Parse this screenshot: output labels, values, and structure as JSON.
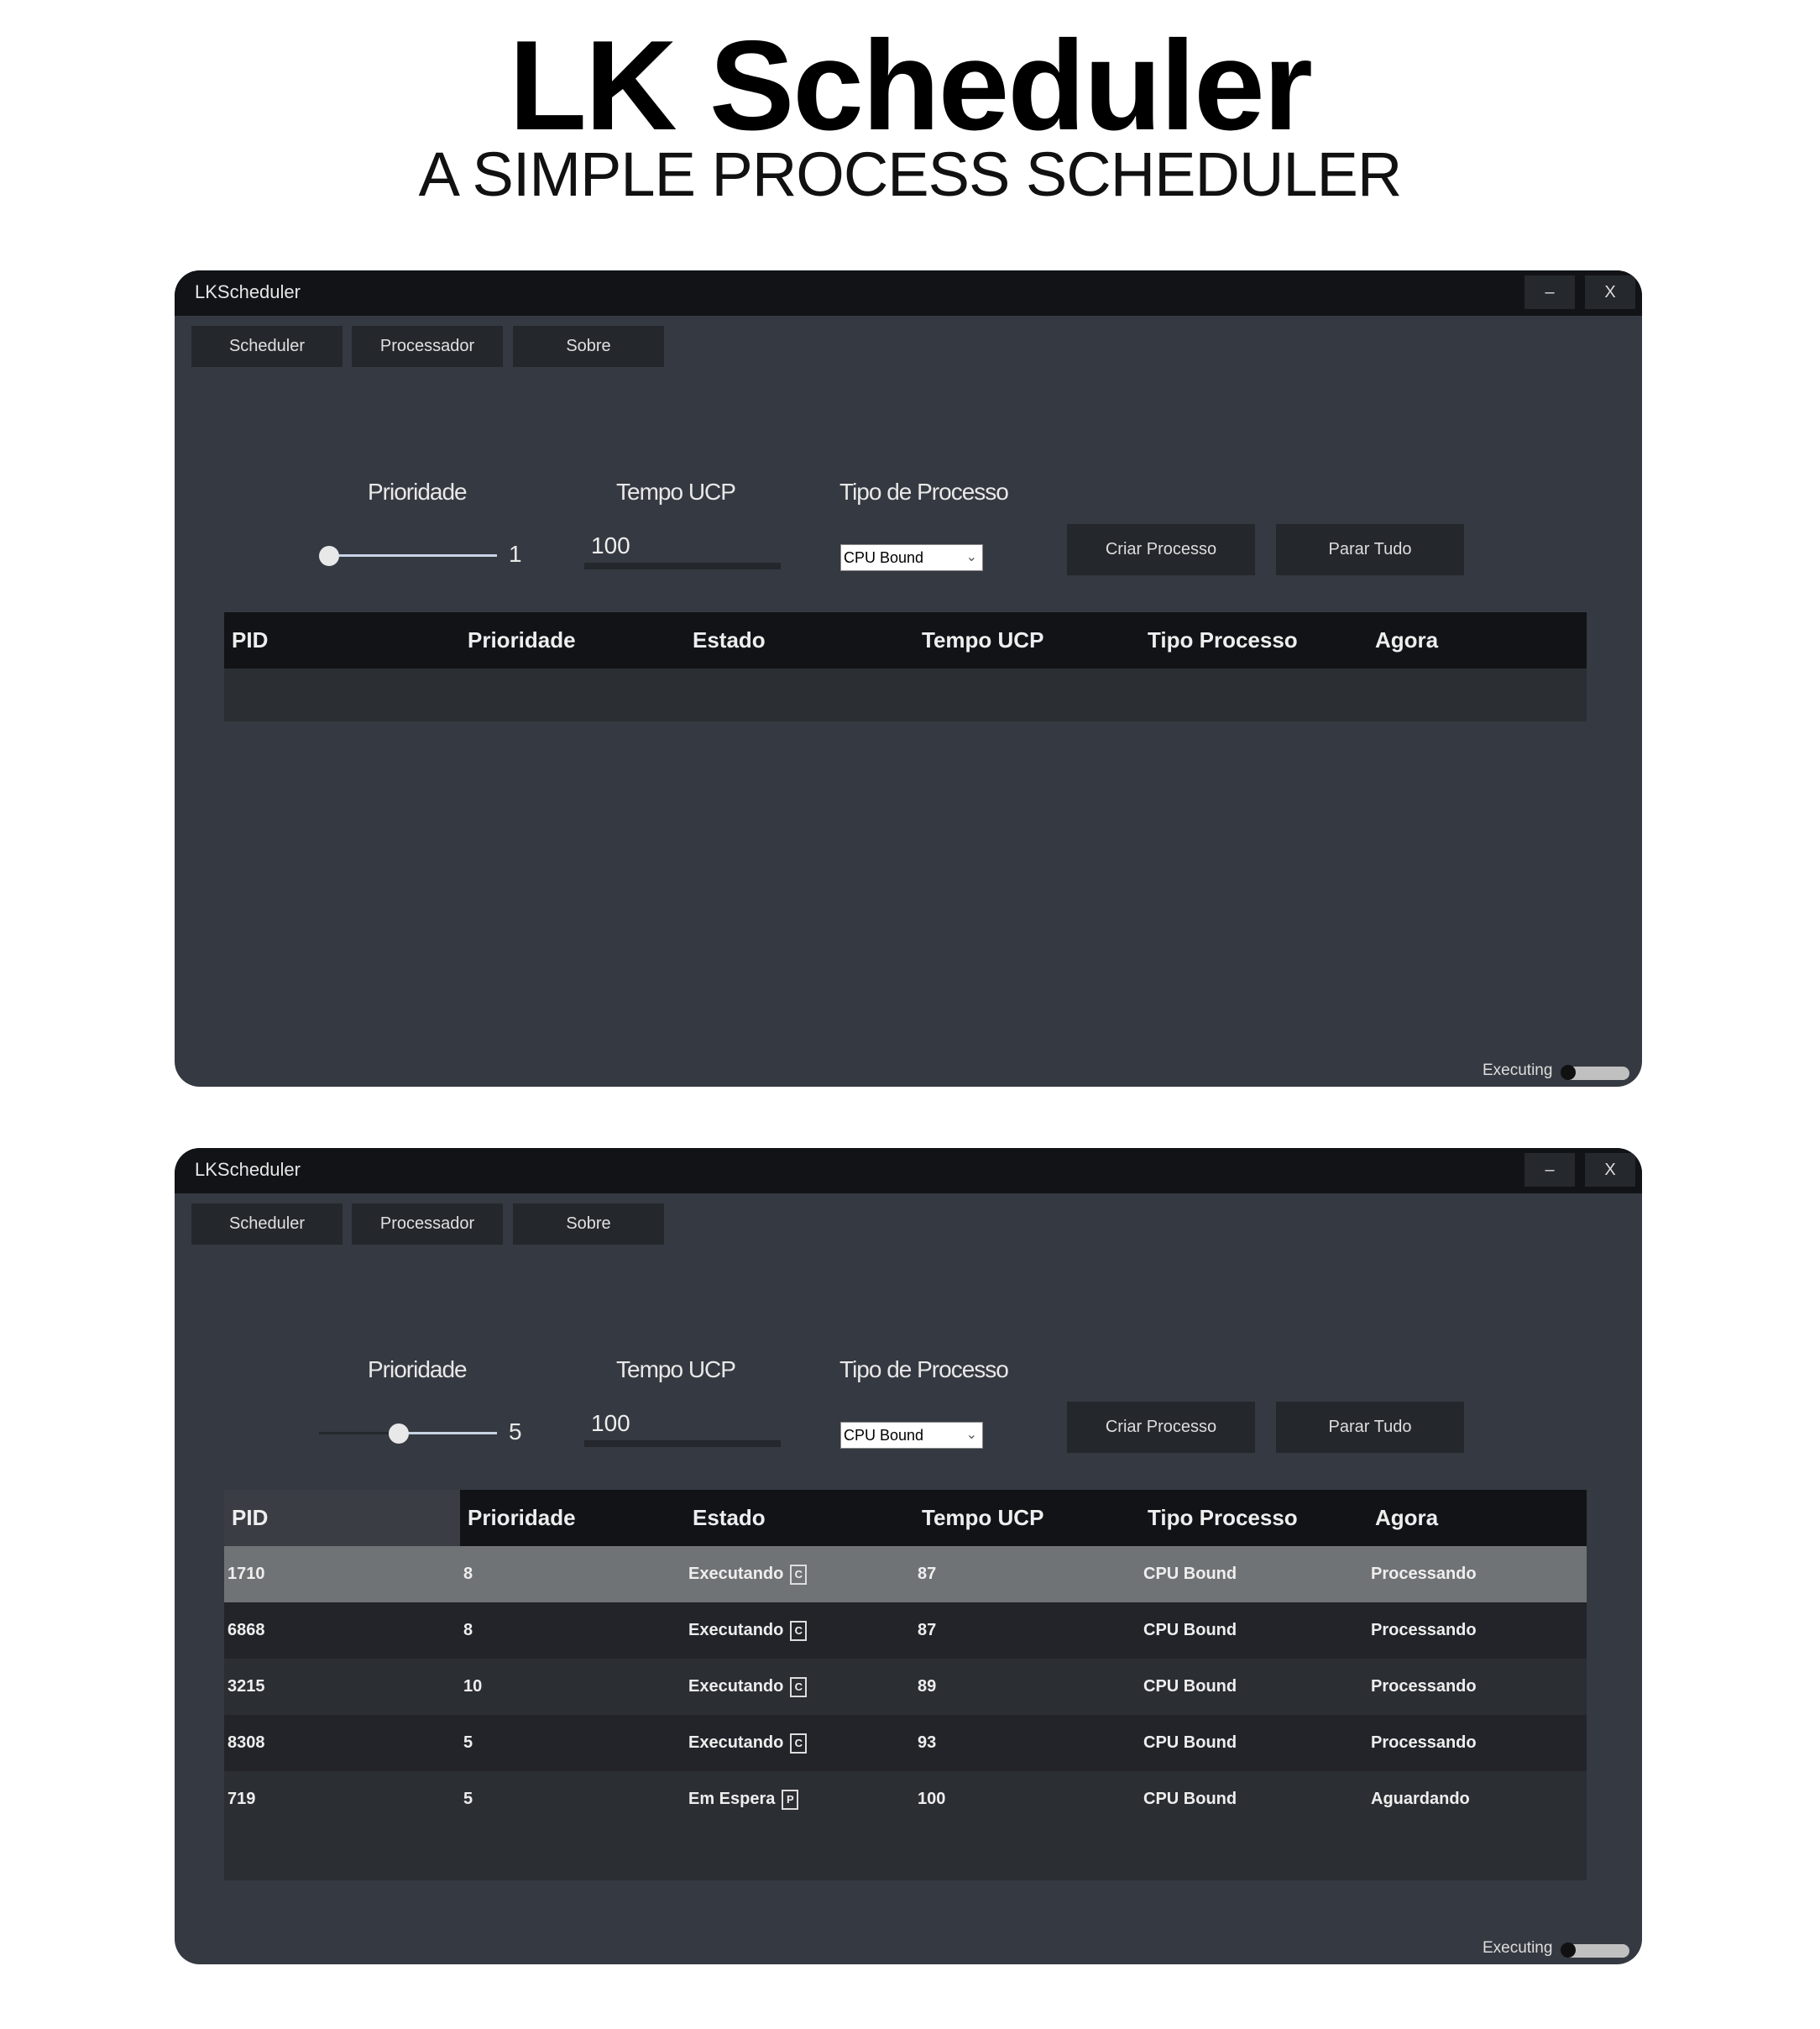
{
  "hero": {
    "title": "LK Scheduler",
    "subtitle": "A SIMPLE PROCESS SCHEDULER"
  },
  "windows": [
    {
      "title": "LKScheduler",
      "minimize": "–",
      "close": "X",
      "nav": [
        "Scheduler",
        "Processador",
        "Sobre"
      ],
      "labels": {
        "priority": "Prioridade",
        "cpu_time": "Tempo UCP",
        "type": "Tipo de Processo"
      },
      "priority_value": "1",
      "priority_fraction": 0,
      "cpu_time_value": "100",
      "type_selected": "CPU Bound",
      "create_label": "Criar Processo",
      "stop_label": "Parar Tudo",
      "columns": [
        "PID",
        "Prioridade",
        "Estado",
        "Tempo UCP",
        "Tipo Processo",
        "Agora"
      ],
      "rows": [],
      "status_label": "Executing"
    },
    {
      "title": "LKScheduler",
      "minimize": "–",
      "close": "X",
      "nav": [
        "Scheduler",
        "Processador",
        "Sobre"
      ],
      "labels": {
        "priority": "Prioridade",
        "cpu_time": "Tempo UCP",
        "type": "Tipo de Processo"
      },
      "priority_value": "5",
      "priority_fraction": 0.44,
      "cpu_time_value": "100",
      "type_selected": "CPU Bound",
      "create_label": "Criar Processo",
      "stop_label": "Parar Tudo",
      "columns": [
        "PID",
        "Prioridade",
        "Estado",
        "Tempo UCP",
        "Tipo Processo",
        "Agora"
      ],
      "rows": [
        {
          "pid": "1710",
          "priority": "8",
          "state": "Executando",
          "icon": "C",
          "cpu": "87",
          "type": "CPU Bound",
          "now": "Processando",
          "selected": true
        },
        {
          "pid": "6868",
          "priority": "8",
          "state": "Executando",
          "icon": "C",
          "cpu": "87",
          "type": "CPU Bound",
          "now": "Processando"
        },
        {
          "pid": "3215",
          "priority": "10",
          "state": "Executando",
          "icon": "C",
          "cpu": "89",
          "type": "CPU Bound",
          "now": "Processando"
        },
        {
          "pid": "8308",
          "priority": "5",
          "state": "Executando",
          "icon": "C",
          "cpu": "93",
          "type": "CPU Bound",
          "now": "Processando"
        },
        {
          "pid": "719",
          "priority": "5",
          "state": "Em Espera",
          "icon": "P",
          "cpu": "100",
          "type": "CPU Bound",
          "now": "Aguardando"
        }
      ],
      "status_label": "Executing"
    }
  ]
}
